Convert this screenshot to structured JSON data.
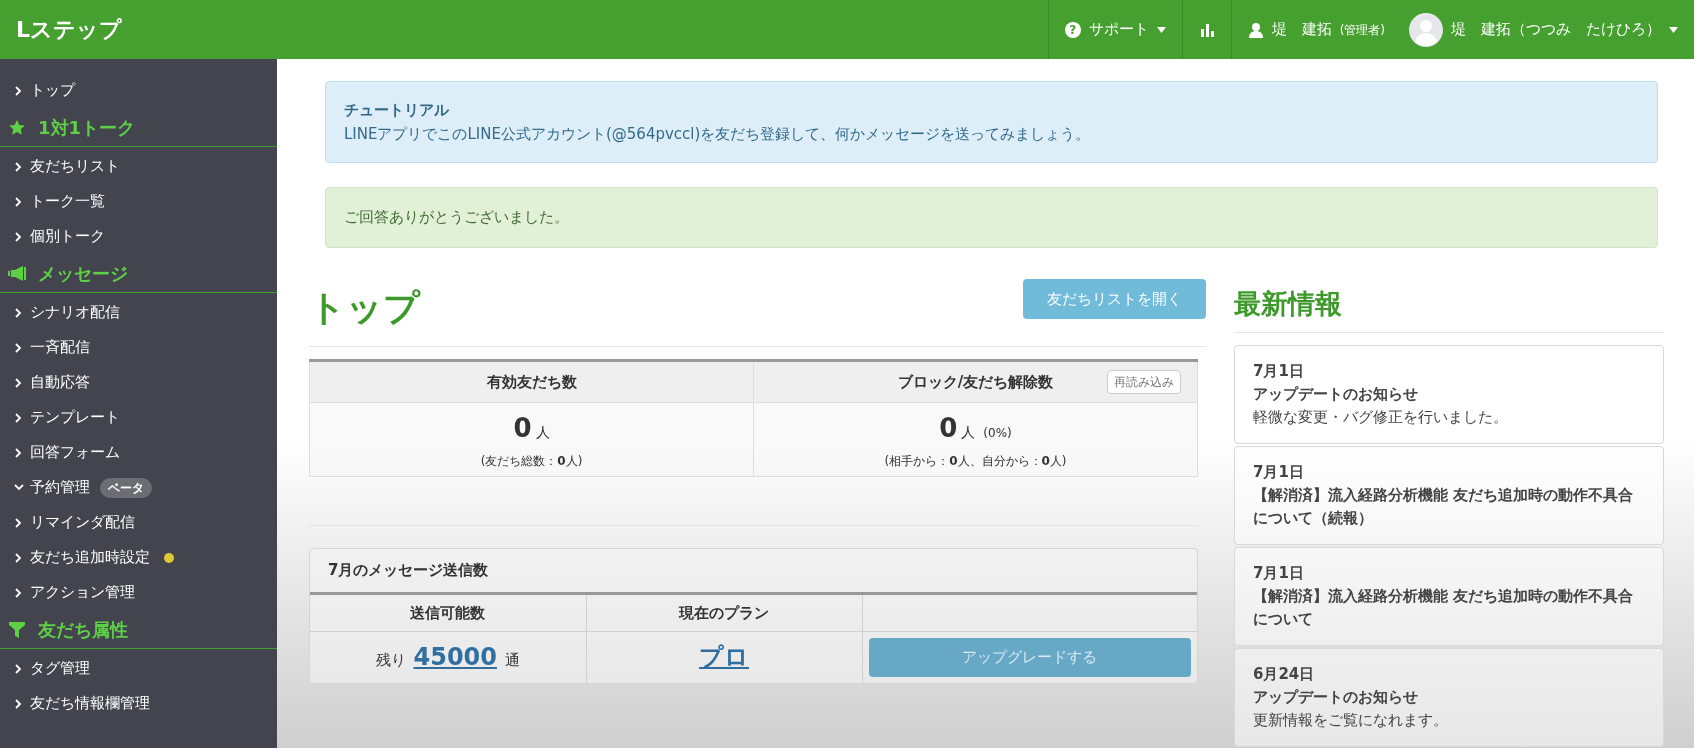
{
  "header": {
    "logo": "Lステップ",
    "help_glyph": "?",
    "support": "サポート",
    "user": "堤　建拓",
    "role": "(管理者)",
    "account": "堤　建拓（つつみ　たけひろ）"
  },
  "sidebar": {
    "items": [
      {
        "kind": "link",
        "label": "トップ",
        "expanded": false,
        "dot": false
      },
      {
        "kind": "section",
        "label": "1対1トーク"
      },
      {
        "kind": "link",
        "label": "友だちリスト",
        "expanded": false,
        "dot": false
      },
      {
        "kind": "link",
        "label": "トーク一覧",
        "expanded": false,
        "dot": false
      },
      {
        "kind": "link",
        "label": "個別トーク",
        "expanded": false,
        "dot": false
      },
      {
        "kind": "section",
        "label": "メッセージ"
      },
      {
        "kind": "link",
        "label": "シナリオ配信",
        "expanded": false,
        "dot": false
      },
      {
        "kind": "link",
        "label": "一斉配信",
        "expanded": false,
        "dot": false
      },
      {
        "kind": "link",
        "label": "自動応答",
        "expanded": false,
        "dot": false
      },
      {
        "kind": "link",
        "label": "テンプレート",
        "expanded": false,
        "dot": false
      },
      {
        "kind": "link",
        "label": "回答フォーム",
        "expanded": false,
        "dot": false
      },
      {
        "kind": "link",
        "label": "予約管理",
        "expanded": true,
        "dot": false,
        "badge": "ベータ"
      },
      {
        "kind": "link",
        "label": "リマインダ配信",
        "expanded": false,
        "dot": false
      },
      {
        "kind": "link",
        "label": "友だち追加時設定",
        "expanded": false,
        "dot": true
      },
      {
        "kind": "link",
        "label": "アクション管理",
        "expanded": false,
        "dot": false
      },
      {
        "kind": "section",
        "label": "友だち属性"
      },
      {
        "kind": "link",
        "label": "タグ管理",
        "expanded": false,
        "dot": false
      },
      {
        "kind": "link",
        "label": "友だち情報欄管理",
        "expanded": false,
        "dot": false
      }
    ]
  },
  "alerts": [
    {
      "kind": "info",
      "title": "チュートリアル",
      "text": "LINEアプリでこのLINE公式アカウント(@564pvccl)を友だち登録して、何かメッセージを送ってみましょう。"
    },
    {
      "kind": "success",
      "text": "ご回答ありがとうございました。"
    }
  ],
  "page_title": "トップ",
  "open_list_button": "友だちリストを開く",
  "stats": {
    "reload_button": "再読み込み",
    "columns": [
      {
        "heading": "有効友だち数",
        "value": "0",
        "unit": "人",
        "detail": "(友だち総数：**0**人)"
      },
      {
        "heading": "ブロック/友だち解除数",
        "value": "0",
        "unit": "人",
        "extra": "(0%)",
        "detail": "(相手から：**0**人、自分から：**0**人)"
      }
    ]
  },
  "messages": {
    "title": "7月のメッセージ送信数",
    "columns": [
      "送信可能数",
      "現在のプラン"
    ],
    "prefix": "残り",
    "count": "45000",
    "suffix": "通",
    "plan": "プロ",
    "upgrade_button": "アップグレードする"
  },
  "news": {
    "title": "最新情報",
    "items": [
      {
        "date": "7月1日",
        "title": "アップデートのお知らせ",
        "body": "軽微な変更・バグ修正を行いました。"
      },
      {
        "date": "7月1日",
        "title": "【解消済】流入経路分析機能 友だち追加時の動作不具合について（続報）"
      },
      {
        "date": "7月1日",
        "title": "【解消済】流入経路分析機能 友だち追加時の動作不具合について"
      },
      {
        "date": "6月24日",
        "title": "アップデートのお知らせ",
        "body": "更新情報をご覧になれます。"
      }
    ]
  }
}
